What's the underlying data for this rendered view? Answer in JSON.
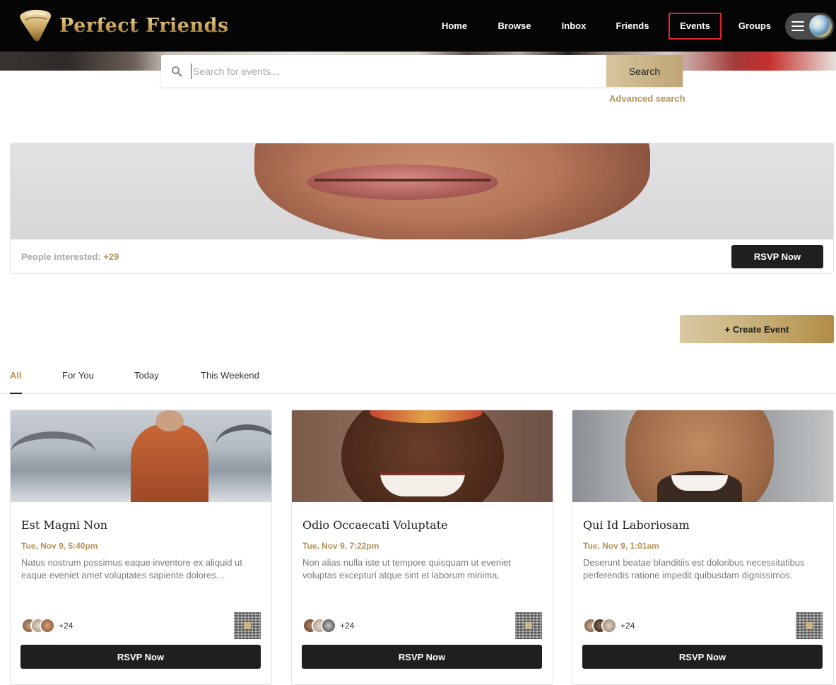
{
  "brand": {
    "name": "Perfect Friends",
    "accent": "#b8925a",
    "nav_active_border": "#e0262a"
  },
  "nav": {
    "items": [
      {
        "label": "Home"
      },
      {
        "label": "Browse"
      },
      {
        "label": "Inbox"
      },
      {
        "label": "Friends"
      },
      {
        "label": "Events",
        "active": true
      },
      {
        "label": "Groups"
      }
    ],
    "menu_icon": "hamburger-icon",
    "avatar_icon": "user-avatar"
  },
  "search": {
    "placeholder": "Search for events...",
    "value": "",
    "button_label": "Search",
    "advanced_label": "Advanced search",
    "icon": "search-icon"
  },
  "featured": {
    "interested_label": "People interested:",
    "interested_count": "+29",
    "rsvp_label": "RSVP Now"
  },
  "create_event_label": "+ Create Event",
  "tabs": [
    {
      "label": "All",
      "active": true
    },
    {
      "label": "For You"
    },
    {
      "label": "Today"
    },
    {
      "label": "This Weekend"
    }
  ],
  "events": [
    {
      "title": "Est Magni Non",
      "date": "Tue, Nov 9, 5:40pm",
      "description": "Natus nostrum possimus eaque inventore ex aliquid ut eaque eveniet amet voluptates sapiente dolores…",
      "attendee_count": "+24",
      "rsvp_label": "RSVP Now"
    },
    {
      "title": "Odio Occaecati Voluptate",
      "date": "Tue, Nov 9, 7:22pm",
      "description": "Non alias nulla iste ut tempore quisquam ut eveniet voluptas excepturi atque sint et laborum minima.",
      "attendee_count": "+24",
      "rsvp_label": "RSVP Now"
    },
    {
      "title": "Qui Id Laboriosam",
      "date": "Tue, Nov 9, 1:01am",
      "description": "Deserunt beatae blanditiis est doloribus necessitatibus perferendis ratione impedit quibusdam dignissimos.",
      "attendee_count": "+24",
      "rsvp_label": "RSVP Now"
    }
  ]
}
